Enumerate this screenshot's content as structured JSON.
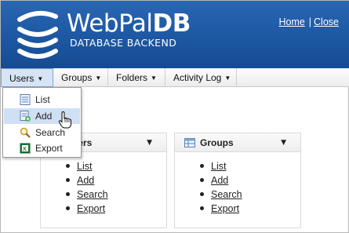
{
  "header": {
    "logo_part1": "WebPal",
    "logo_part2": "DB",
    "logo_sub": "DATABASE BACKEND",
    "home_link": "Home",
    "separator": "|",
    "close_link": "Close"
  },
  "menubar": {
    "items": [
      {
        "label": "Users"
      },
      {
        "label": "Groups"
      },
      {
        "label": "Folders"
      },
      {
        "label": "Activity Log"
      }
    ]
  },
  "dropdown": {
    "items": [
      {
        "label": "List",
        "icon": "list-icon"
      },
      {
        "label": "Add",
        "icon": "add-icon"
      },
      {
        "label": "Search",
        "icon": "search-icon"
      },
      {
        "label": "Export",
        "icon": "export-icon"
      }
    ],
    "active_index": 1
  },
  "panels": [
    {
      "title": "Users",
      "links": [
        "List",
        "Add",
        "Search",
        "Export"
      ]
    },
    {
      "title": "Groups",
      "links": [
        "List",
        "Add",
        "Search",
        "Export"
      ]
    }
  ],
  "colors": {
    "header_blue": "#1f5aa6",
    "menu_active": "#d6e4f5",
    "dropdown_hover": "#cfe0f5"
  }
}
